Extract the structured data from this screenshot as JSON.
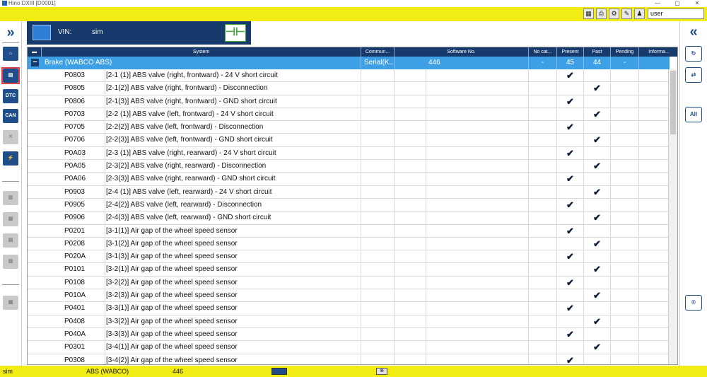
{
  "window": {
    "title": "Hino DXIII [D0001]",
    "min": "—",
    "max": "▢",
    "close": "✕"
  },
  "toolbar": {
    "user_label": "user",
    "icons": [
      "calculator-icon",
      "printer-icon",
      "gear-icon",
      "edit-icon",
      "user-icon"
    ]
  },
  "vin": {
    "label": "VIN:",
    "value": "sim"
  },
  "table": {
    "columns": [
      "System",
      "Commun...",
      "Software No.",
      "No cat...",
      "Present",
      "Past",
      "Pending",
      "Informa..."
    ],
    "group": {
      "name": "Brake (WABCO ABS)",
      "comm": "Serial(K...",
      "software": "446",
      "no_cat": "-",
      "present": "45",
      "past": "44",
      "pending": "-"
    },
    "rows": [
      {
        "code": "P0803",
        "desc": "[2-1 (1)] ABS valve (right, frontward) - 24 V short circuit",
        "present": true,
        "past": false
      },
      {
        "code": "P0805",
        "desc": "[2-1(2)] ABS valve (right, frontward) - Disconnection",
        "present": false,
        "past": true
      },
      {
        "code": "P0806",
        "desc": "[2-1(3)] ABS valve (right, frontward) - GND short circuit",
        "present": true,
        "past": false
      },
      {
        "code": "P0703",
        "desc": "[2-2 (1)] ABS valve (left, frontward) - 24 V short circuit",
        "present": false,
        "past": true
      },
      {
        "code": "P0705",
        "desc": "[2-2(2)] ABS valve (left, frontward) - Disconnection",
        "present": true,
        "past": false
      },
      {
        "code": "P0706",
        "desc": "[2-2(3)] ABS valve (left, frontward) - GND short circuit",
        "present": false,
        "past": true
      },
      {
        "code": "P0A03",
        "desc": "[2-3 (1)] ABS valve (right, rearward) - 24 V short circuit",
        "present": true,
        "past": false
      },
      {
        "code": "P0A05",
        "desc": "[2-3(2)] ABS valve (right, rearward) - Disconnection",
        "present": false,
        "past": true
      },
      {
        "code": "P0A06",
        "desc": "[2-3(3)] ABS valve (right, rearward) - GND short circuit",
        "present": true,
        "past": false
      },
      {
        "code": "P0903",
        "desc": "[2-4 (1)] ABS valve (left, rearward) - 24 V short circuit",
        "present": false,
        "past": true
      },
      {
        "code": "P0905",
        "desc": "[2-4(2)] ABS valve (left, rearward) - Disconnection",
        "present": true,
        "past": false
      },
      {
        "code": "P0906",
        "desc": "[2-4(3)] ABS valve (left, rearward) - GND short circuit",
        "present": false,
        "past": true
      },
      {
        "code": "P0201",
        "desc": "[3-1(1)] Air gap of the wheel speed sensor",
        "present": true,
        "past": false
      },
      {
        "code": "P0208",
        "desc": "[3-1(2)] Air gap of the wheel speed sensor",
        "present": false,
        "past": true
      },
      {
        "code": "P020A",
        "desc": "[3-1(3)] Air gap of the wheel speed sensor",
        "present": true,
        "past": false
      },
      {
        "code": "P0101",
        "desc": "[3-2(1)] Air gap of the wheel speed sensor",
        "present": false,
        "past": true
      },
      {
        "code": "P0108",
        "desc": "[3-2(2)] Air gap of the wheel speed sensor",
        "present": true,
        "past": false
      },
      {
        "code": "P010A",
        "desc": "[3-2(3)] Air gap of the wheel speed sensor",
        "present": false,
        "past": true
      },
      {
        "code": "P0401",
        "desc": "[3-3(1)] Air gap of the wheel speed sensor",
        "present": true,
        "past": false
      },
      {
        "code": "P0408",
        "desc": "[3-3(2)] Air gap of the wheel speed sensor",
        "present": false,
        "past": true
      },
      {
        "code": "P040A",
        "desc": "[3-3(3)] Air gap of the wheel speed sensor",
        "present": true,
        "past": false
      },
      {
        "code": "P0301",
        "desc": "[3-4(1)] Air gap of the wheel speed sensor",
        "present": false,
        "past": true
      },
      {
        "code": "P0308",
        "desc": "[3-4(2)] Air gap of the wheel speed sensor",
        "present": true,
        "past": false
      }
    ]
  },
  "left_nav": {
    "expand": "»",
    "dtc": "DTC",
    "can": "CAN"
  },
  "right_nav": {
    "collapse": "«",
    "all": "All"
  },
  "status": {
    "vin": "sim",
    "system": "ABS (WABCO)",
    "software": "446"
  },
  "check_glyph": "✔"
}
